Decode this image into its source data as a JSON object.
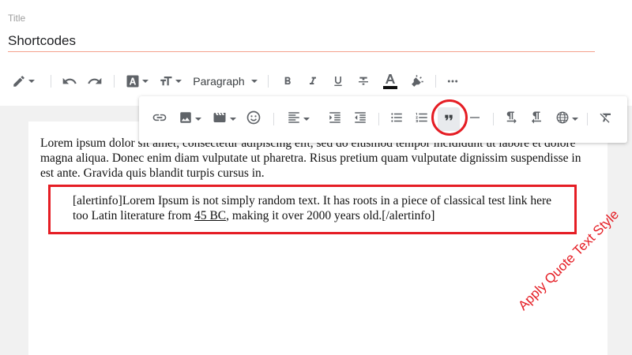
{
  "title": {
    "label": "Title",
    "value": "Shortcodes"
  },
  "toolbar": {
    "block_format": "Paragraph",
    "items": [
      "pen-icon",
      "undo-icon",
      "redo-icon",
      "font-color-icon",
      "text-size-icon",
      "block-format-select",
      "bold-icon",
      "italic-icon",
      "underline-icon",
      "strikethrough-icon",
      "text-color-icon",
      "highlight-icon",
      "more-icon"
    ]
  },
  "insert_toolbar": {
    "items": [
      "link-icon",
      "image-icon",
      "video-icon",
      "emoji-icon",
      "align-icon",
      "indent-icon",
      "outdent-icon",
      "bulleted-list-icon",
      "numbered-list-icon",
      "quote-icon",
      "horizontal-rule-icon",
      "ltr-icon",
      "rtl-icon",
      "language-icon",
      "clear-format-icon"
    ],
    "active": "quote-icon"
  },
  "editor": {
    "paragraph": "Lorem ipsum dolor sit amet, consectetur adipiscing elit, sed do eiusmod tempor incididunt ut labore et dolore magna aliqua. Donec enim diam vulputate ut pharetra. Risus pretium quam vulputate dignissim suspendisse in est ante. Gravida quis blandit turpis cursus in.",
    "quote_before": "[alertinfo]Lorem Ipsum is not simply random text. It has roots in a piece of classical test link here too Latin literature from ",
    "quote_link": "45 BC",
    "quote_after": ", making it over 2000 years old.[/alertinfo]"
  },
  "annotation": "Apply Quote Text Style",
  "colors": {
    "accent": "#e51d24",
    "title_underline": "#f4a28c",
    "canvas": "#f1f1f1"
  }
}
